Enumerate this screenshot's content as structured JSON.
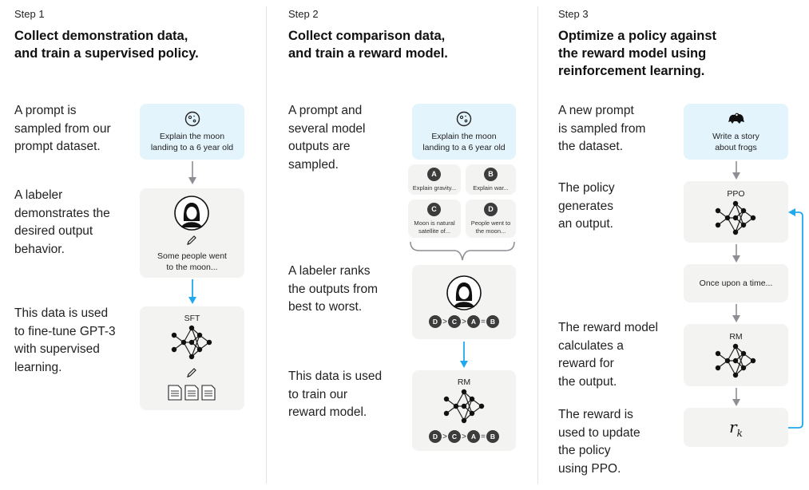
{
  "colors": {
    "blue_arrow": "#20a9ee",
    "gray_arrow": "#8d8d94",
    "box_gray": "#f3f3f2",
    "box_blue": "#e4f4fc"
  },
  "step1": {
    "step_label": "Step 1",
    "title": "Collect demonstration data,\nand train a supervised policy.",
    "desc1": "A prompt is\nsampled from our\nprompt dataset.",
    "desc2": "A labeler\ndemonstrates the\ndesired output\nbehavior.",
    "desc3": "This data is used\nto fine-tune GPT-3\nwith supervised\nlearning.",
    "prompt_icon": "moon-icon",
    "prompt_text": "Explain the moon\nlanding to a 6 year old",
    "labeler_icon": "labeler-avatar-icon",
    "demo_text": "Some people went\nto the moon...",
    "model_label": "SFT",
    "model_icon": "neural-network-icon",
    "data_icon": "documents-icon"
  },
  "step2": {
    "step_label": "Step 2",
    "title": "Collect comparison data,\nand train a reward model.",
    "desc1": "A prompt and\nseveral model\noutputs are\nsampled.",
    "desc2": "A labeler ranks\nthe outputs from\nbest to worst.",
    "desc3": "This data is used\nto train our\nreward model.",
    "prompt_icon": "moon-icon",
    "prompt_text": "Explain the moon\nlanding to a 6 year old",
    "outputs": [
      {
        "letter": "A",
        "text": "Explain gravity..."
      },
      {
        "letter": "B",
        "text": "Explain war..."
      },
      {
        "letter": "C",
        "text": "Moon is natural\nsatellite of..."
      },
      {
        "letter": "D",
        "text": "People went to\nthe moon..."
      }
    ],
    "ranking": [
      "D",
      ">",
      "C",
      ">",
      "A",
      "=",
      "B"
    ],
    "model_label": "RM"
  },
  "step3": {
    "step_label": "Step 3",
    "title": "Optimize a policy against\nthe reward model using\nreinforcement learning.",
    "desc1": "A new prompt\nis sampled from\nthe dataset.",
    "desc2": "The policy\ngenerates\nan output.",
    "desc3": "The reward model\ncalculates a\nreward for\nthe output.",
    "desc4": "The reward is\nused to update\nthe policy\nusing PPO.",
    "prompt_icon": "frog-icon",
    "prompt_text": "Write a story\nabout frogs",
    "policy_label": "PPO",
    "output_text": "Once upon a time...",
    "rm_label": "RM",
    "reward_symbol": "r",
    "reward_subscript": "k"
  }
}
